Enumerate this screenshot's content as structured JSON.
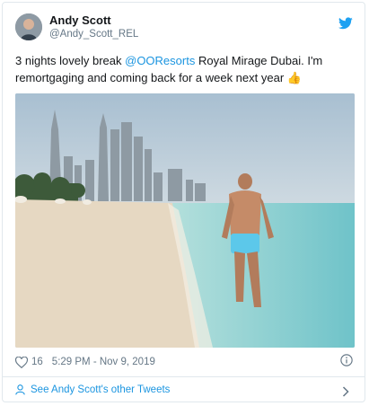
{
  "user": {
    "name": "Andy Scott",
    "handle": "@Andy_Scott_REL"
  },
  "tweet": {
    "text_before": "3 nights lovely break ",
    "mention": "@OOResorts",
    "text_after": " Royal Mirage Dubai. I'm remortgaging and coming back for a week next year ",
    "emoji": "👍"
  },
  "meta": {
    "likes": "16",
    "timestamp": "5:29 PM - Nov 9, 2019"
  },
  "footer": {
    "more_tweets_label": "See Andy Scott's other Tweets"
  },
  "icons": {
    "brand": "twitter-bird-icon",
    "like": "heart-icon",
    "info": "info-icon",
    "person": "person-icon",
    "chevron": "chevron-right-icon"
  },
  "colors": {
    "accent": "#1da1f2",
    "link": "#1b95e0",
    "muted": "#657786",
    "border": "#e1e8ed"
  }
}
